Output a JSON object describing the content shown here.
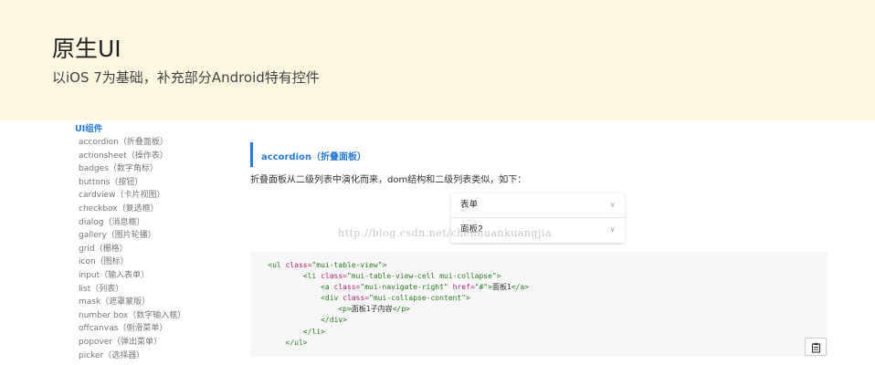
{
  "banner": {
    "title": "原生UI",
    "subtitle": "以iOS 7为基础，补充部分Android特有控件"
  },
  "sidebar": {
    "heading": "UI组件",
    "items": [
      {
        "label": "accordion（折叠面板）"
      },
      {
        "label": "actionsheet（操作表）"
      },
      {
        "label": "badges（数字角标）"
      },
      {
        "label": "buttons（按钮）"
      },
      {
        "label": "cardview（卡片视图）"
      },
      {
        "label": "checkbox（复选框）"
      },
      {
        "label": "dialog（消息框）"
      },
      {
        "label": "gallery（图片轮播）"
      },
      {
        "label": "grid（栅格）"
      },
      {
        "label": "icon（图标）"
      },
      {
        "label": "input（输入表单）"
      },
      {
        "label": "list（列表）"
      },
      {
        "label": "mask（遮罩蒙版）"
      },
      {
        "label": "number box（数字输入框）"
      },
      {
        "label": "offcanvas（侧滑菜单）"
      },
      {
        "label": "popover（弹出菜单）"
      },
      {
        "label": "picker（选择器）"
      }
    ]
  },
  "main": {
    "section_title": "accordion（折叠面板）",
    "description": "折叠面板从二级列表中演化而来，dom结构和二级列表类似，如下：",
    "demo": {
      "rows": [
        {
          "label": "表单"
        },
        {
          "label": "面板2"
        }
      ]
    },
    "watermark": "http://blog.csdn.net/chenhuankuangjia",
    "code": {
      "lines": [
        {
          "indent": "",
          "parts": [
            {
              "t": "<ul ",
              "c": "tag"
            },
            {
              "t": "class=",
              "c": "attr"
            },
            {
              "t": "\"mui-table-view\"",
              "c": "str"
            },
            {
              "t": ">",
              "c": "tag"
            }
          ]
        },
        {
          "indent": "        ",
          "parts": [
            {
              "t": "<li ",
              "c": "tag"
            },
            {
              "t": "class=",
              "c": "attr"
            },
            {
              "t": "\"mui-table-view-cell mui-collapse\"",
              "c": "str"
            },
            {
              "t": ">",
              "c": "tag"
            }
          ]
        },
        {
          "indent": "            ",
          "parts": [
            {
              "t": "<a ",
              "c": "tag"
            },
            {
              "t": "class=",
              "c": "attr"
            },
            {
              "t": "\"mui-navigate-right\" ",
              "c": "str"
            },
            {
              "t": "href=",
              "c": "attr"
            },
            {
              "t": "\"#\"",
              "c": "str"
            },
            {
              "t": ">",
              "c": "tag"
            },
            {
              "t": "面板1",
              "c": "txt"
            },
            {
              "t": "</a>",
              "c": "tag"
            }
          ]
        },
        {
          "indent": "            ",
          "parts": [
            {
              "t": "<div ",
              "c": "tag"
            },
            {
              "t": "class=",
              "c": "attr"
            },
            {
              "t": "\"mui-collapse-content\"",
              "c": "str"
            },
            {
              "t": ">",
              "c": "tag"
            }
          ]
        },
        {
          "indent": "                ",
          "parts": [
            {
              "t": "<p>",
              "c": "tag"
            },
            {
              "t": "面板1子内容",
              "c": "txt"
            },
            {
              "t": "</p>",
              "c": "tag"
            }
          ]
        },
        {
          "indent": "            ",
          "parts": [
            {
              "t": "</div>",
              "c": "tag"
            }
          ]
        },
        {
          "indent": "        ",
          "parts": [
            {
              "t": "</li>",
              "c": "tag"
            }
          ]
        },
        {
          "indent": "    ",
          "parts": [
            {
              "t": "</ul>",
              "c": "tag"
            }
          ]
        }
      ]
    },
    "copy_button_icon": "clipboard-icon"
  },
  "colors": {
    "banner_bg": "#fdf6e1",
    "accent": "#2b7bd9",
    "code_bg": "#f7f7f8"
  }
}
